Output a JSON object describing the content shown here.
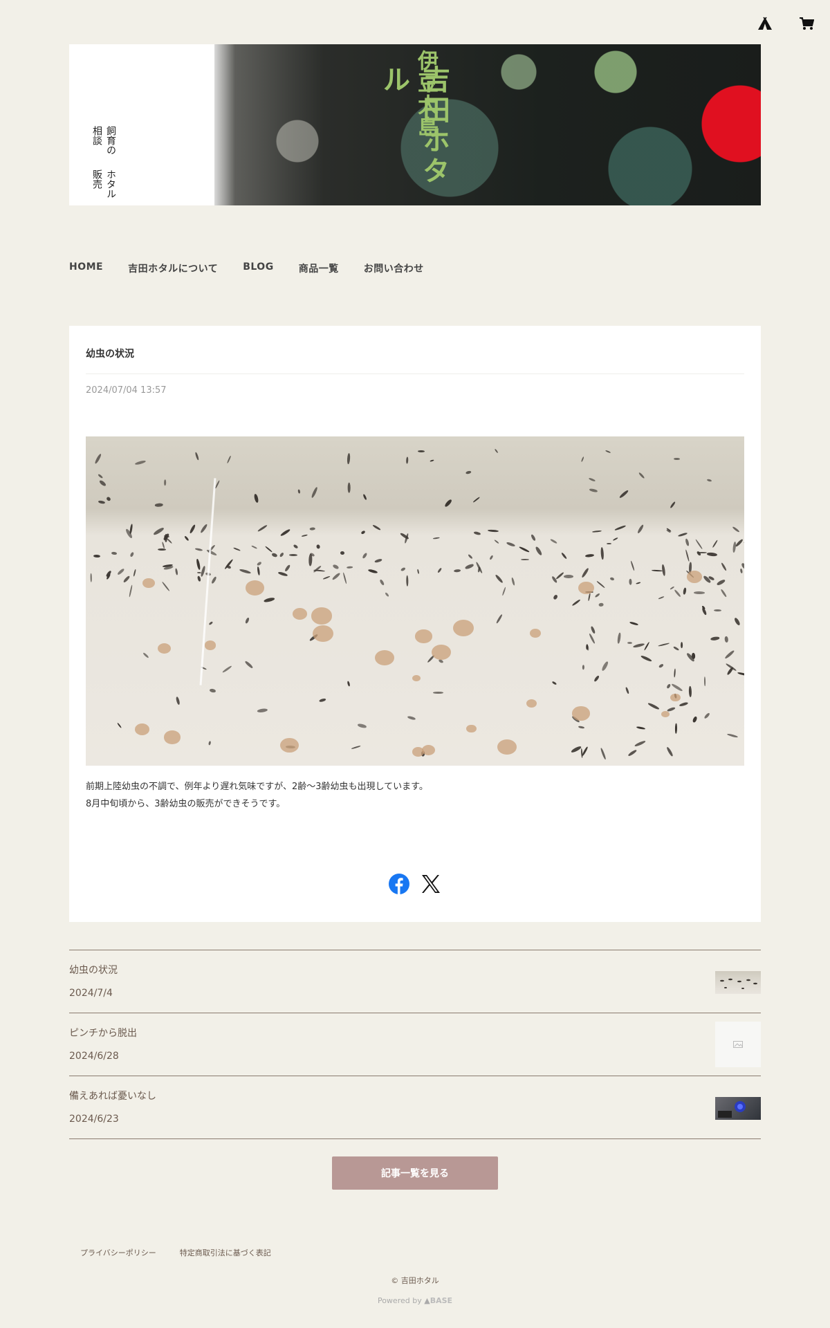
{
  "header": {
    "icons": {
      "logo": "tent-icon",
      "cart": "cart-icon"
    }
  },
  "banner": {
    "small_line1": "ホタル販売",
    "small_line2": "飼育の相談",
    "big_line1": "伊豆大島",
    "big_line2": "吉田ホタル"
  },
  "nav": {
    "items": [
      {
        "label": "HOME"
      },
      {
        "label": "吉田ホタルについて"
      },
      {
        "label": "BLOG"
      },
      {
        "label": "商品一覧"
      },
      {
        "label": "お問い合わせ"
      }
    ]
  },
  "post": {
    "title": "幼虫の状況",
    "date": "2024/07/04 13:57",
    "body_line1": "前期上陸幼虫の不調で、例年より遅れ気味ですが、2齢〜3齢幼虫も出現しています。",
    "body_line2": "8月中旬頃から、3齢幼虫の販売ができそうです。",
    "share": {
      "facebook": "facebook-icon",
      "x": "x-icon"
    }
  },
  "related": [
    {
      "title": "幼虫の状況",
      "date": "2024/7/4"
    },
    {
      "title": "ピンチから脱出",
      "date": "2024/6/28"
    },
    {
      "title": "備えあれば憂いなし",
      "date": "2024/6/23"
    }
  ],
  "more_button": "記事一覧を見る",
  "footer": {
    "links": [
      {
        "label": "プライバシーポリシー"
      },
      {
        "label": "特定商取引法に基づく表記"
      }
    ],
    "copyright": "© 吉田ホタル",
    "powered_by": "Powered by",
    "powered_brand": "BASE"
  },
  "colors": {
    "background": "#f2f0e8",
    "button": "#b89895",
    "divider": "#8a7a6e",
    "accent_green": "#9cc46a"
  }
}
